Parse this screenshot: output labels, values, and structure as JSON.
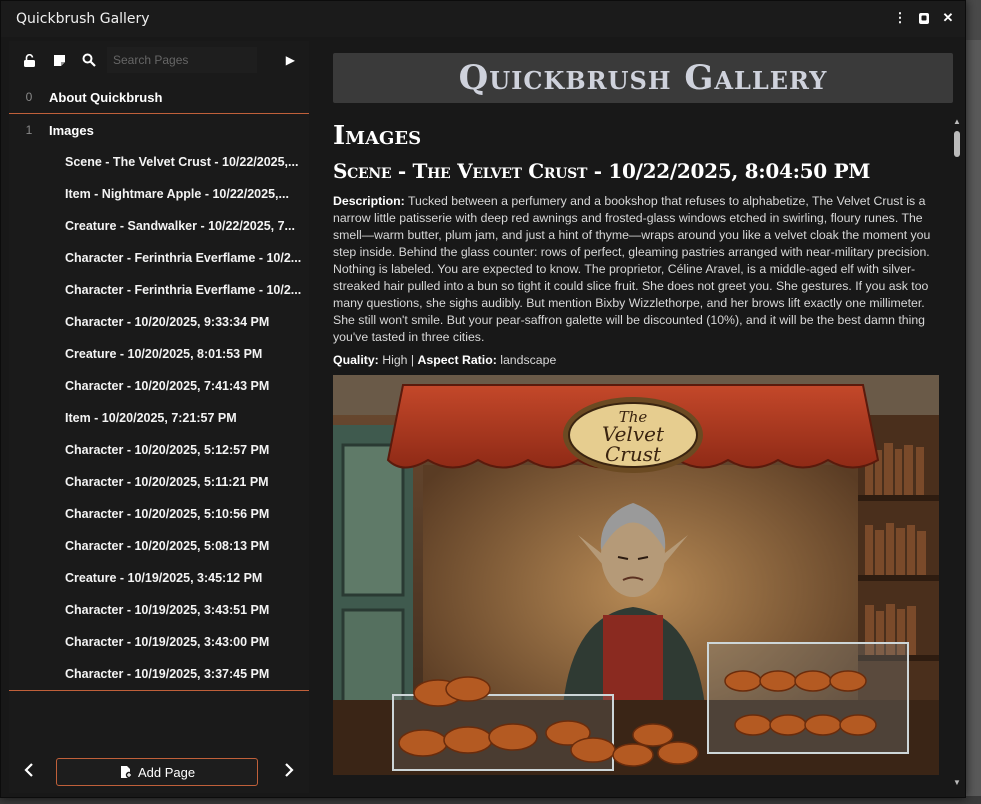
{
  "window": {
    "title": "Quickbrush Gallery"
  },
  "title_controls": [
    {
      "name": "menu-icon",
      "glyph": "⋮"
    },
    {
      "name": "journal-icon",
      "glyph": "▣"
    },
    {
      "name": "close-icon",
      "glyph": "✕"
    }
  ],
  "sidebar": {
    "search_placeholder": "Search Pages",
    "pages": [
      {
        "num": "0",
        "label": "About Quickbrush"
      },
      {
        "num": "1",
        "label": "Images"
      }
    ],
    "sub_pages": [
      "Scene - The Velvet Crust - 10/22/2025,...",
      "Item - Nightmare Apple - 10/22/2025,...",
      "Creature - Sandwalker - 10/22/2025, 7...",
      "Character - Ferinthria Everflame - 10/2...",
      "Character - Ferinthria Everflame - 10/2...",
      "Character - 10/20/2025, 9:33:34 PM",
      "Creature - 10/20/2025, 8:01:53 PM",
      "Character - 10/20/2025, 7:41:43 PM",
      "Item - 10/20/2025, 7:21:57 PM",
      "Character - 10/20/2025, 5:12:57 PM",
      "Character - 10/20/2025, 5:11:21 PM",
      "Character - 10/20/2025, 5:10:56 PM",
      "Character - 10/20/2025, 5:08:13 PM",
      "Creature - 10/19/2025, 3:45:12 PM",
      "Character - 10/19/2025, 3:43:51 PM",
      "Character - 10/19/2025, 3:43:00 PM",
      "Character - 10/19/2025, 3:37:45 PM"
    ],
    "add_page_label": "Add Page"
  },
  "main": {
    "banner": "Quickbrush Gallery",
    "section_heading": "Images",
    "scene_heading": "Scene - The Velvet Crust - 10/22/2025, 8:04:50 PM",
    "description_label": "Description:",
    "description": "Tucked between a perfumery and a bookshop that refuses to alphabetize, The Velvet Crust is a narrow little patisserie with deep red awnings and frosted-glass windows etched in swirling, floury runes. The smell—warm butter, plum jam, and just a hint of thyme—wraps around you like a velvet cloak the moment you step inside. Behind the glass counter: rows of perfect, gleaming pastries arranged with near-military precision. Nothing is labeled. You are expected to know. The proprietor, Céline Aravel, is a middle-aged elf with silver-streaked hair pulled into a bun so tight it could slice fruit. She does not greet you. She gestures. If you ask too many questions, she sighs audibly. But mention Bixby Wizzlethorpe, and her brows lift exactly one millimeter. She still won't smile. But your pear-saffron galette will be discounted (10%), and it will be the best damn thing you've tasted in three cities.",
    "quality_label": "Quality:",
    "quality": "High",
    "separator": "|",
    "aspect_label": "Aspect Ratio:",
    "aspect": "landscape",
    "sign_line1": "The",
    "sign_line2": "Velvet",
    "sign_line3": "Crust"
  },
  "colors": {
    "accent": "#c0603a",
    "awning": "#b4381f",
    "background": "#181818"
  }
}
